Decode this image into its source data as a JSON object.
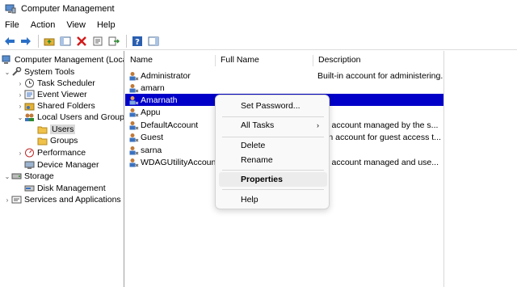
{
  "window": {
    "title": "Computer Management"
  },
  "menu": [
    "File",
    "Action",
    "View",
    "Help"
  ],
  "toolbar_icons": [
    "back-arrow-icon",
    "forward-arrow-icon",
    "up-folder-icon",
    "show-hide-tree-icon",
    "delete-icon",
    "properties-icon",
    "export-list-icon",
    "help-icon",
    "show-action-pane-icon"
  ],
  "tree": {
    "root": "Computer Management (Local",
    "system_tools": "System Tools",
    "task_scheduler": "Task Scheduler",
    "event_viewer": "Event Viewer",
    "shared_folders": "Shared Folders",
    "local_users": "Local Users and Groups",
    "users": "Users",
    "groups": "Groups",
    "performance": "Performance",
    "device_manager": "Device Manager",
    "storage": "Storage",
    "disk_management": "Disk Management",
    "services": "Services and Applications"
  },
  "columns": {
    "name": "Name",
    "full_name": "Full Name",
    "description": "Description"
  },
  "users": [
    {
      "name": "Administrator",
      "description": "Built-in account for administering..."
    },
    {
      "name": "amarn",
      "description": ""
    },
    {
      "name": "Amarnath",
      "description": ""
    },
    {
      "name": "Appu",
      "description": ""
    },
    {
      "name": "DefaultAccount",
      "description": "ser account managed by the s..."
    },
    {
      "name": "Guest",
      "description": "ilt-in account for guest access t..."
    },
    {
      "name": "sarna",
      "description": ""
    },
    {
      "name": "WDAGUtilityAccount",
      "description": "ser account managed and use..."
    }
  ],
  "context_menu": {
    "set_password": "Set Password...",
    "all_tasks": "All Tasks",
    "delete": "Delete",
    "rename": "Rename",
    "properties": "Properties",
    "help": "Help"
  },
  "colors": {
    "selection": "#0000c8",
    "accent": "#1f5fbf"
  }
}
